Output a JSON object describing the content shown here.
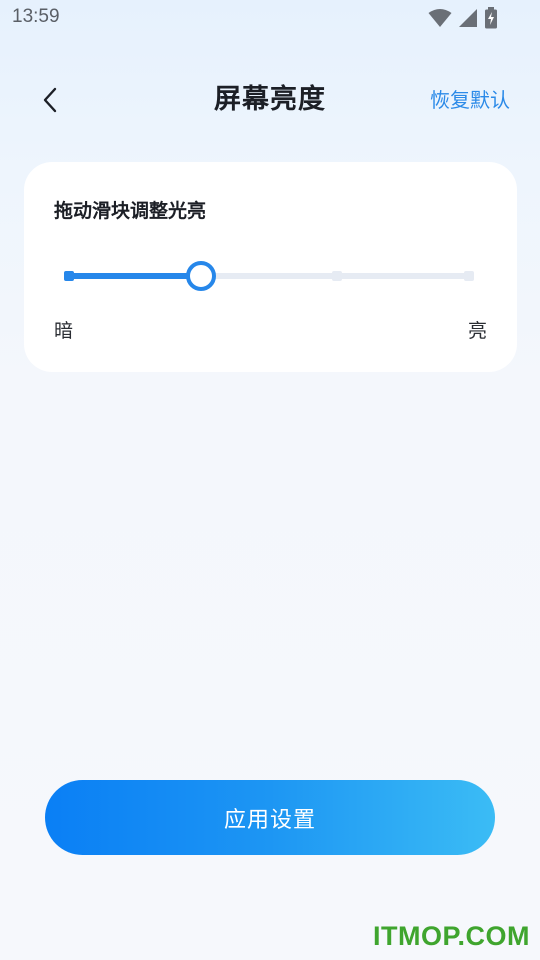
{
  "status_bar": {
    "time": "13:59",
    "icons": [
      "wifi-icon",
      "cellular-signal-icon",
      "battery-charging-icon"
    ]
  },
  "header": {
    "back_icon": "chevron-left-icon",
    "title": "屏幕亮度",
    "reset_label": "恢复默认"
  },
  "brightness_card": {
    "title": "拖动滑块调整光亮",
    "slider": {
      "min_label": "暗",
      "max_label": "亮",
      "value": 0.33,
      "stops": [
        0,
        0.33,
        0.67,
        1.0
      ]
    }
  },
  "apply_button": {
    "label": "应用设置"
  },
  "watermark": "ITMOP.COM",
  "colors": {
    "accent": "#2687ea",
    "link": "#2b8ae8",
    "track": "#e6ebf3",
    "button_gradient_start": "#0a7ff5",
    "button_gradient_end": "#3bbcf5",
    "watermark": "#3fa52e"
  }
}
